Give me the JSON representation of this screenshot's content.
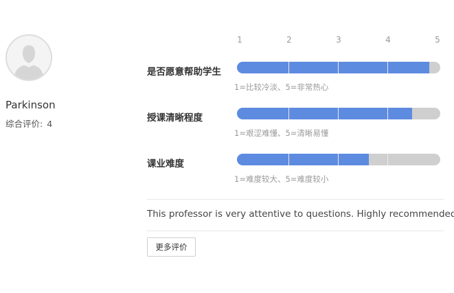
{
  "professor": {
    "name": "Parkinson",
    "overall_label": "综合评价:",
    "overall_value": "4"
  },
  "scale": [
    "1",
    "2",
    "3",
    "4",
    "5"
  ],
  "metrics": [
    {
      "label": "是否愿意帮助学生",
      "value": 4.79,
      "legend": "1=比较冷淡、5=非常热心"
    },
    {
      "label": "授课清晰程度",
      "value": 4.44,
      "legend": "1=艰涩难懂、5=清晰易懂"
    },
    {
      "label": "课业难度",
      "value": 3.6,
      "legend": "1=难度较大、5=难度较小"
    }
  ],
  "comment": "This professor is very attentive to questions. Highly recommended.",
  "more_button": "更多评价",
  "colors": {
    "bar_fill": "#5d8be0",
    "bar_track": "#cfcfcf"
  }
}
